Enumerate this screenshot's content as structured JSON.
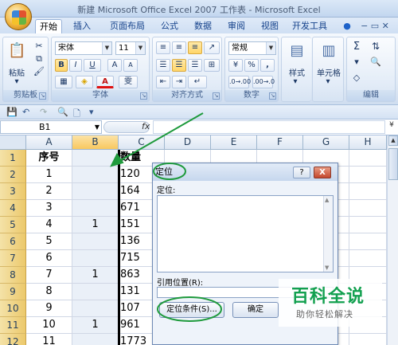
{
  "window": {
    "title": "新建 Microsoft Office Excel 2007 工作表 - Microsoft Excel"
  },
  "tabs": [
    "开始",
    "插入",
    "页面布局",
    "公式",
    "数据",
    "审阅",
    "视图",
    "开发工具"
  ],
  "ribbon": {
    "paste_label": "粘贴",
    "clipboard_group": "剪贴板",
    "font_name": "宋体",
    "font_size": "11",
    "bold": "B",
    "italic": "I",
    "underline": "U",
    "grow_font": "A",
    "shrink_font": "A",
    "font_color_glyph": "A",
    "phonetic": "雯",
    "font_group": "字体",
    "alignment_group": "对齐方式",
    "number_format": "常规",
    "percent": "%",
    "comma": ",",
    "number_group": "数字",
    "styles_label": "样式",
    "cells_label": "单元格",
    "sum_glyph": "Σ",
    "editing_group": "编辑"
  },
  "formula_bar": {
    "name_box": "B1",
    "fx": "fx",
    "formula": ""
  },
  "sheet": {
    "columns": [
      "A",
      "B",
      "C",
      "D",
      "E",
      "F",
      "G",
      "H"
    ],
    "rows": [
      {
        "n": "1",
        "a": "序号",
        "b": "",
        "c": "数量"
      },
      {
        "n": "2",
        "a": "1",
        "b": "",
        "c": "120"
      },
      {
        "n": "3",
        "a": "2",
        "b": "",
        "c": "164"
      },
      {
        "n": "4",
        "a": "3",
        "b": "",
        "c": "671"
      },
      {
        "n": "5",
        "a": "4",
        "b": "1",
        "c": "151"
      },
      {
        "n": "6",
        "a": "5",
        "b": "",
        "c": "136"
      },
      {
        "n": "7",
        "a": "6",
        "b": "",
        "c": "715"
      },
      {
        "n": "8",
        "a": "7",
        "b": "1",
        "c": "863"
      },
      {
        "n": "9",
        "a": "8",
        "b": "",
        "c": "131"
      },
      {
        "n": "10",
        "a": "9",
        "b": "",
        "c": "107"
      },
      {
        "n": "11",
        "a": "10",
        "b": "1",
        "c": "961"
      },
      {
        "n": "12",
        "a": "11",
        "b": "",
        "c": "1773"
      }
    ]
  },
  "dialog": {
    "title": "定位",
    "help": "?",
    "close": "X",
    "list_label": "定位:",
    "reference_label": "引用位置(R):",
    "reference_value": "",
    "special_button": "定位条件(S)...",
    "ok_button": "确定"
  },
  "watermark": {
    "title": "百科全说",
    "subtitle": "助你轻松解决"
  },
  "annotation_color": "#1e9a3c"
}
